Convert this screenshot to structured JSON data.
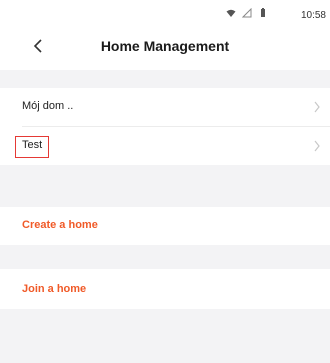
{
  "status_bar": {
    "time": "10:58",
    "icons": [
      "wifi-icon",
      "signal-icon",
      "battery-icon"
    ]
  },
  "header": {
    "title": "Home Management",
    "back_icon": "chevron-left-icon"
  },
  "homes": [
    {
      "label": "Mój dom .."
    },
    {
      "label": "Test",
      "highlighted": true
    }
  ],
  "actions": {
    "create_label": "Create a home",
    "join_label": "Join a home"
  },
  "colors": {
    "accent": "#f05a28",
    "highlight_border": "#e53935",
    "background_gap": "#f3f3f5"
  }
}
